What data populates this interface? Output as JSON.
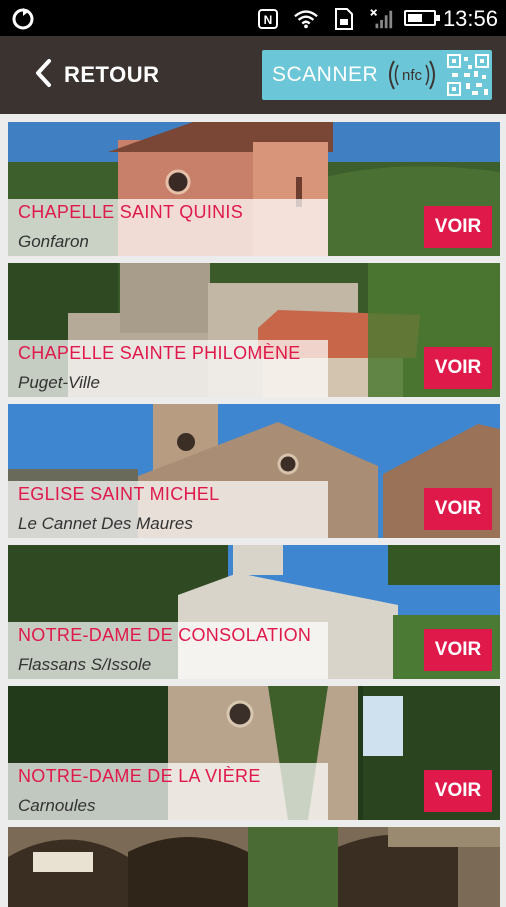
{
  "statusbar": {
    "time": "13:56",
    "battery_level": 0.6,
    "icons": [
      "sync-icon",
      "nfc-status-icon",
      "wifi-icon",
      "sim-icon",
      "no-signal-icon",
      "battery-icon"
    ]
  },
  "header": {
    "back_label": "RETOUR",
    "scanner_label": "SCANNER",
    "nfc_text": "nfc"
  },
  "colors": {
    "accent": "#e0194b",
    "header_bg": "#3b3330",
    "scanner_bg": "#6bc7d7"
  },
  "places": [
    {
      "title": "CHAPELLE SAINT QUINIS",
      "location": "Gonfaron",
      "button": "VOIR"
    },
    {
      "title": "CHAPELLE SAINTE PHILOMÈNE",
      "location": "Puget-Ville",
      "button": "VOIR"
    },
    {
      "title": "EGLISE SAINT MICHEL",
      "location": "Le Cannet Des Maures",
      "button": "VOIR"
    },
    {
      "title": "NOTRE-DAME DE CONSOLATION",
      "location": "Flassans S/Issole",
      "button": "VOIR"
    },
    {
      "title": "NOTRE-DAME DE LA VIÈRE",
      "location": "Carnoules",
      "button": "VOIR"
    }
  ]
}
